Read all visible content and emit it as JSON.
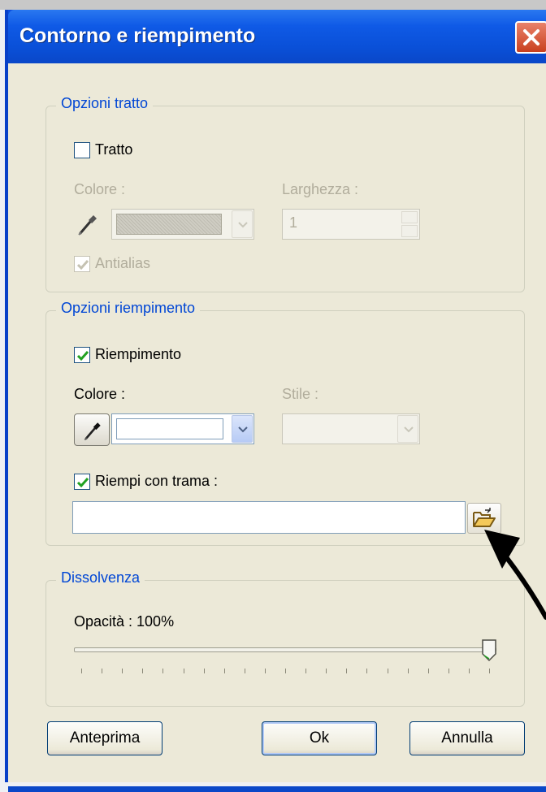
{
  "window": {
    "title": "Contorno e riempimento"
  },
  "stroke": {
    "legend": "Opzioni tratto",
    "checkbox_label": "Tratto",
    "checked": false,
    "color_label": "Colore :",
    "width_label": "Larghezza :",
    "width_value": "1",
    "antialias_label": "Antialias",
    "antialias_checked": true
  },
  "fill": {
    "legend": "Opzioni riempimento",
    "checkbox_label": "Riempimento",
    "checked": true,
    "color_label": "Colore :",
    "style_label": "Stile :",
    "texture_label": "Riempi con trama :",
    "texture_checked": true,
    "texture_path": ""
  },
  "fade": {
    "legend": "Dissolvenza",
    "opacity_label": "Opacità : 100%",
    "opacity_value": 100
  },
  "buttons": {
    "preview": "Anteprima",
    "ok": "Ok",
    "cancel": "Annulla"
  },
  "colors": {
    "title_bar": "#0a50d8",
    "legend_text": "#0046d5",
    "dialog_bg": "#ece9d8",
    "disabled_text": "#b1ad9c",
    "check_green": "#21a121"
  },
  "icons": {
    "close": "close-icon",
    "eyedropper": "eyedropper-icon",
    "browse": "open-folder-icon",
    "annotation": "arrow-annotation"
  }
}
